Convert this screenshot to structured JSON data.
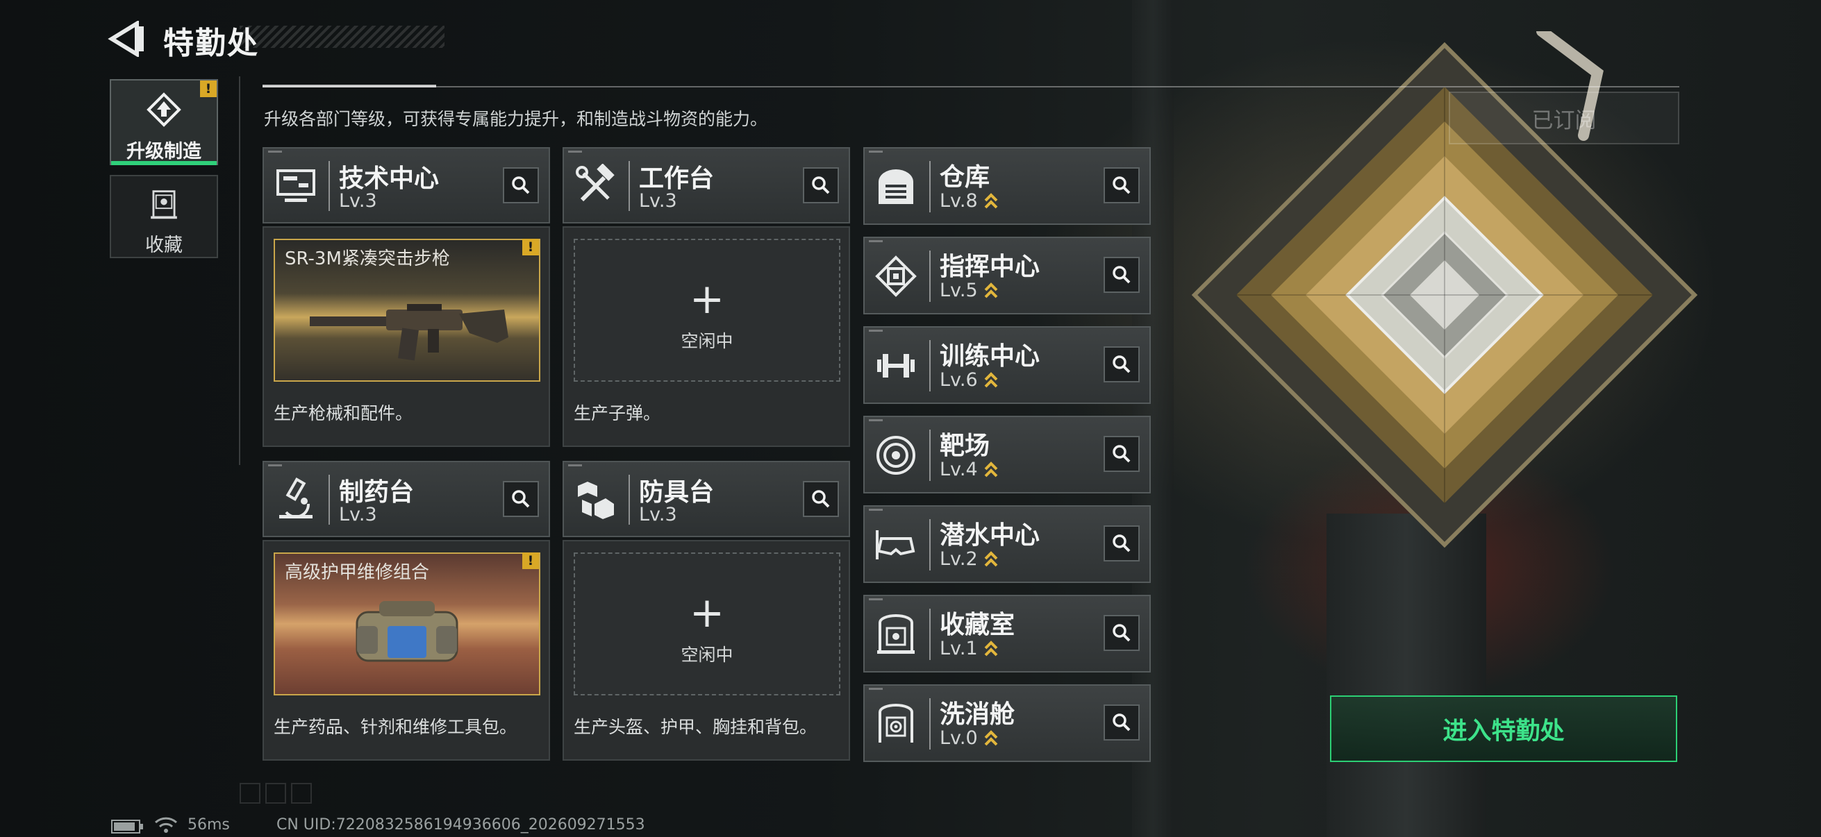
{
  "header": {
    "title": "特勤处"
  },
  "description": "升级各部门等级，可获得专属能力提升，和制造战斗物资的能力。",
  "subscribed_label": "已订阅",
  "sidebar": {
    "items": [
      {
        "label": "升级制造",
        "icon": "upgrade-icon",
        "active": true,
        "alert": "!"
      },
      {
        "label": "收藏",
        "icon": "collection-icon",
        "active": false
      }
    ]
  },
  "facilities": [
    {
      "name": "技术中心",
      "level": "Lv.3",
      "icon": "computer-icon",
      "production": {
        "state": "producing",
        "item": "SR-3M紧凑突击步枪",
        "alert": "!"
      },
      "description": "生产枪械和配件。"
    },
    {
      "name": "工作台",
      "level": "Lv.3",
      "icon": "tools-icon",
      "production": {
        "state": "idle",
        "plus": "+",
        "idle_text": "空闲中"
      },
      "description": "生产子弹。"
    },
    {
      "name": "制药台",
      "level": "Lv.3",
      "icon": "microscope-icon",
      "production": {
        "state": "producing",
        "item": "高级护甲维修组合",
        "alert": "!"
      },
      "description": "生产药品、针剂和维修工具包。"
    },
    {
      "name": "防具台",
      "level": "Lv.3",
      "icon": "armor-icon",
      "production": {
        "state": "idle",
        "plus": "+",
        "idle_text": "空闲中"
      },
      "description": "生产头盔、护甲、胸挂和背包。"
    }
  ],
  "departments": [
    {
      "name": "仓库",
      "level": "Lv.8",
      "icon": "warehouse-icon",
      "upgradable": true
    },
    {
      "name": "指挥中心",
      "level": "Lv.5",
      "icon": "chip-icon",
      "upgradable": true
    },
    {
      "name": "训练中心",
      "level": "Lv.6",
      "icon": "dumbbell-icon",
      "upgradable": true
    },
    {
      "name": "靶场",
      "level": "Lv.4",
      "icon": "target-icon",
      "upgradable": true
    },
    {
      "name": "潜水中心",
      "level": "Lv.2",
      "icon": "diving-mask-icon",
      "upgradable": true
    },
    {
      "name": "收藏室",
      "level": "Lv.1",
      "icon": "collection-room-icon",
      "upgradable": true
    },
    {
      "name": "洗消舱",
      "level": "Lv.0",
      "icon": "decon-icon",
      "upgradable": true
    }
  ],
  "enter_button": "进入特勤处",
  "status_bar": {
    "ping": "56ms",
    "uid": "CN UID:7220832586194936606_202609271553"
  },
  "colors": {
    "accent_green": "#2ccf74",
    "warning_yellow": "#d9a826",
    "upgrade_arrow": "#e2b63c"
  }
}
